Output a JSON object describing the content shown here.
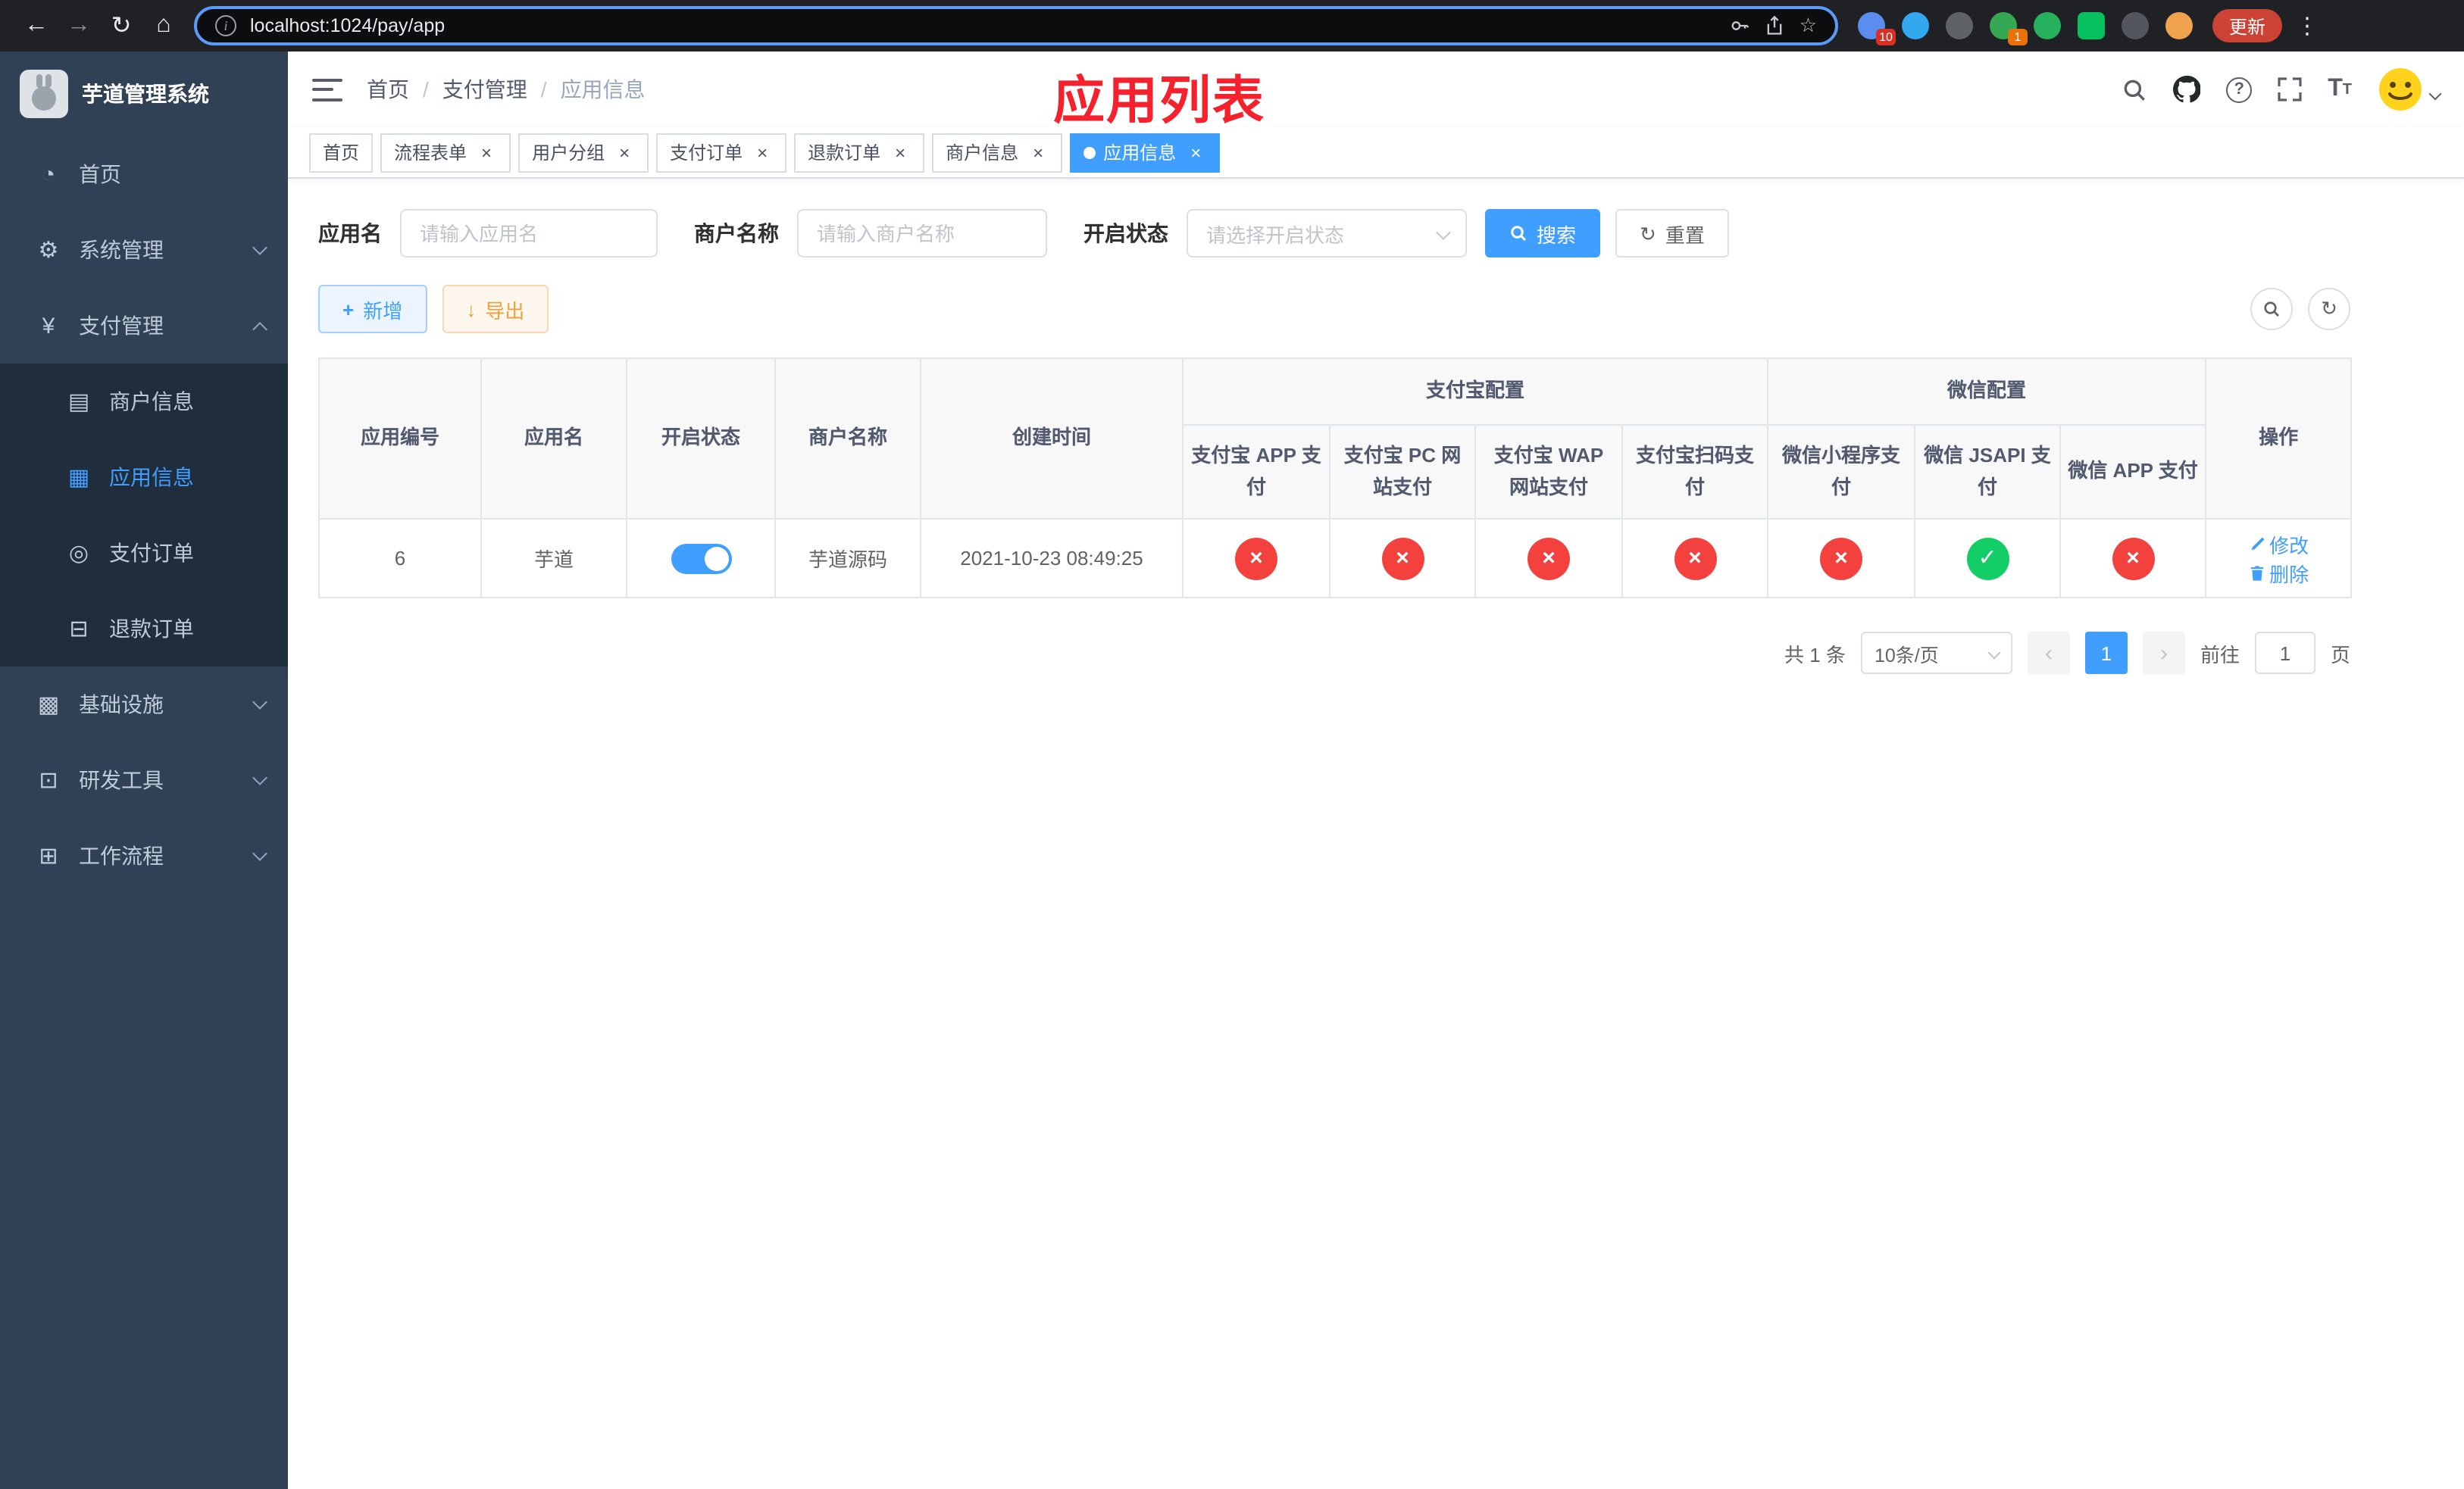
{
  "browser": {
    "url": "localhost:1024/pay/app",
    "update_label": "更新",
    "extension_badge": "10",
    "message_badge": "1"
  },
  "sidebar": {
    "title": "芋道管理系统",
    "items": [
      {
        "label": "首页",
        "glyph": "◔"
      },
      {
        "label": "系统管理",
        "glyph": "⚙"
      },
      {
        "label": "支付管理",
        "glyph": "¥"
      },
      {
        "label": "基础设施",
        "glyph": "▩"
      },
      {
        "label": "研发工具",
        "glyph": "⊡"
      },
      {
        "label": "工作流程",
        "glyph": "⊞"
      }
    ],
    "payment_children": [
      {
        "label": "商户信息",
        "glyph": "▤"
      },
      {
        "label": "应用信息",
        "glyph": "▦"
      },
      {
        "label": "支付订单",
        "glyph": "◎"
      },
      {
        "label": "退款订单",
        "glyph": "⊟"
      }
    ]
  },
  "header": {
    "breadcrumb": [
      "首页",
      "支付管理",
      "应用信息"
    ],
    "annotation": "应用列表"
  },
  "tags": [
    {
      "label": "首页"
    },
    {
      "label": "流程表单"
    },
    {
      "label": "用户分组"
    },
    {
      "label": "支付订单"
    },
    {
      "label": "退款订单"
    },
    {
      "label": "商户信息"
    },
    {
      "label": "应用信息"
    }
  ],
  "filters": {
    "app_name_label": "应用名",
    "app_name_placeholder": "请输入应用名",
    "merchant_label": "商户名称",
    "merchant_placeholder": "请输入商户名称",
    "status_label": "开启状态",
    "status_placeholder": "请选择开启状态",
    "search_button": "搜索",
    "reset_button": "重置"
  },
  "toolbar": {
    "add_button": "新增",
    "export_button": "导出"
  },
  "table": {
    "group_headers": {
      "alipay": "支付宝配置",
      "wechat": "微信配置"
    },
    "columns": {
      "id": "应用编号",
      "name": "应用名",
      "status": "开启状态",
      "merchant": "商户名称",
      "created": "创建时间",
      "alipay_app": "支付宝 APP 支付",
      "alipay_pc": "支付宝 PC 网站支付",
      "alipay_wap": "支付宝 WAP 网站支付",
      "alipay_qr": "支付宝扫码支付",
      "wx_lite": "微信小程序支付",
      "wx_jsapi": "微信 JSAPI 支付",
      "wx_app": "微信 APP 支付",
      "actions": "操作"
    },
    "rows": [
      {
        "id": "6",
        "name": "芋道",
        "enabled": true,
        "merchant": "芋道源码",
        "created": "2021-10-23 08:49:25",
        "alipay_app": false,
        "alipay_pc": false,
        "alipay_wap": false,
        "alipay_qr": false,
        "wx_lite": false,
        "wx_jsapi": true,
        "wx_app": false,
        "edit_label": "修改",
        "delete_label": "删除"
      }
    ]
  },
  "pagination": {
    "total": "共 1 条",
    "page_size": "10条/页",
    "page": "1",
    "goto_label": "前往",
    "goto_value": "1",
    "goto_suffix": "页"
  },
  "colors": {
    "primary": "#409eff",
    "success": "#13ce66",
    "danger": "#f3413e",
    "warning": "#e6a23c",
    "annotation": "#f5222d",
    "sidebar_bg": "#304156",
    "submenu_bg": "#1f2d3d"
  }
}
